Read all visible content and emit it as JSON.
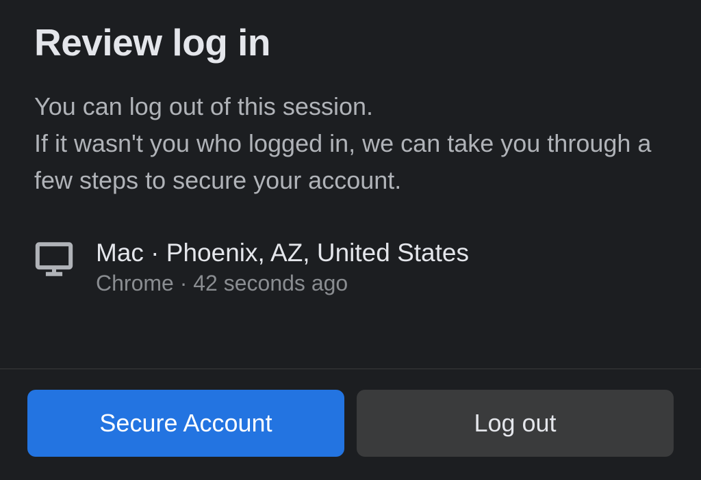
{
  "dialog": {
    "title": "Review log in",
    "description_line1": "You can log out of this session.",
    "description_line2": "If it wasn't you who logged in, we can take you through a few steps to secure your account."
  },
  "session": {
    "device": "Mac",
    "location": "Phoenix, AZ, United States",
    "separator": " · ",
    "browser": "Chrome",
    "time": "42 seconds ago"
  },
  "actions": {
    "primary_label": "Secure Account",
    "secondary_label": "Log out"
  },
  "colors": {
    "background": "#1c1e21",
    "primary_button": "#2374e1",
    "secondary_button": "#3a3b3c",
    "text_primary": "#e4e6eb",
    "text_secondary": "#b0b3b8",
    "text_muted": "#8a8d91"
  }
}
